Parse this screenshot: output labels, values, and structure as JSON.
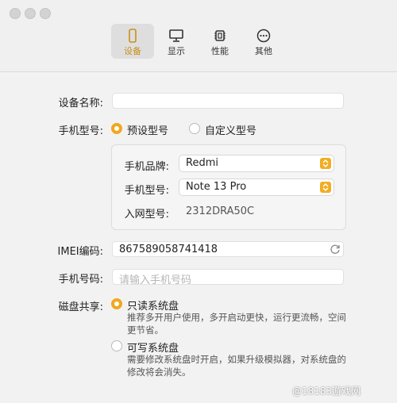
{
  "toolbar": {
    "tabs": [
      {
        "label": "设备",
        "icon": "phone-icon",
        "active": true
      },
      {
        "label": "显示",
        "icon": "monitor-icon",
        "active": false
      },
      {
        "label": "性能",
        "icon": "chip-icon",
        "active": false
      },
      {
        "label": "其他",
        "icon": "more-icon",
        "active": false
      }
    ]
  },
  "form": {
    "device_name_label": "设备名称:",
    "device_name_value": "",
    "model_label": "手机型号:",
    "model_options": {
      "preset": "预设型号",
      "custom": "自定义型号",
      "selected": "preset"
    },
    "brand_label": "手机品牌:",
    "brand_value": "Redmi",
    "phone_model_label": "手机型号:",
    "phone_model_value": "Note 13 Pro",
    "network_model_label": "入网型号:",
    "network_model_value": "2312DRA50C",
    "imei_label": "IMEI编码:",
    "imei_value": "867589058741418",
    "phone_number_label": "手机号码:",
    "phone_number_placeholder": "请输入手机号码",
    "disk_label": "磁盘共享:",
    "disk_options": [
      {
        "title": "只读系统盘",
        "desc1": "推荐多开用户使用，多开启动更快，运行更流畅，空间",
        "desc2": "更节省。",
        "selected": true
      },
      {
        "title": "可写系统盘",
        "desc1": "需要修改系统盘时开启，如果升级模拟器，对系统盘的",
        "desc2": "修改将会消失。",
        "selected": false
      }
    ]
  },
  "watermark": "@18183游戏网",
  "colors": {
    "accent": "#f0a81e"
  }
}
